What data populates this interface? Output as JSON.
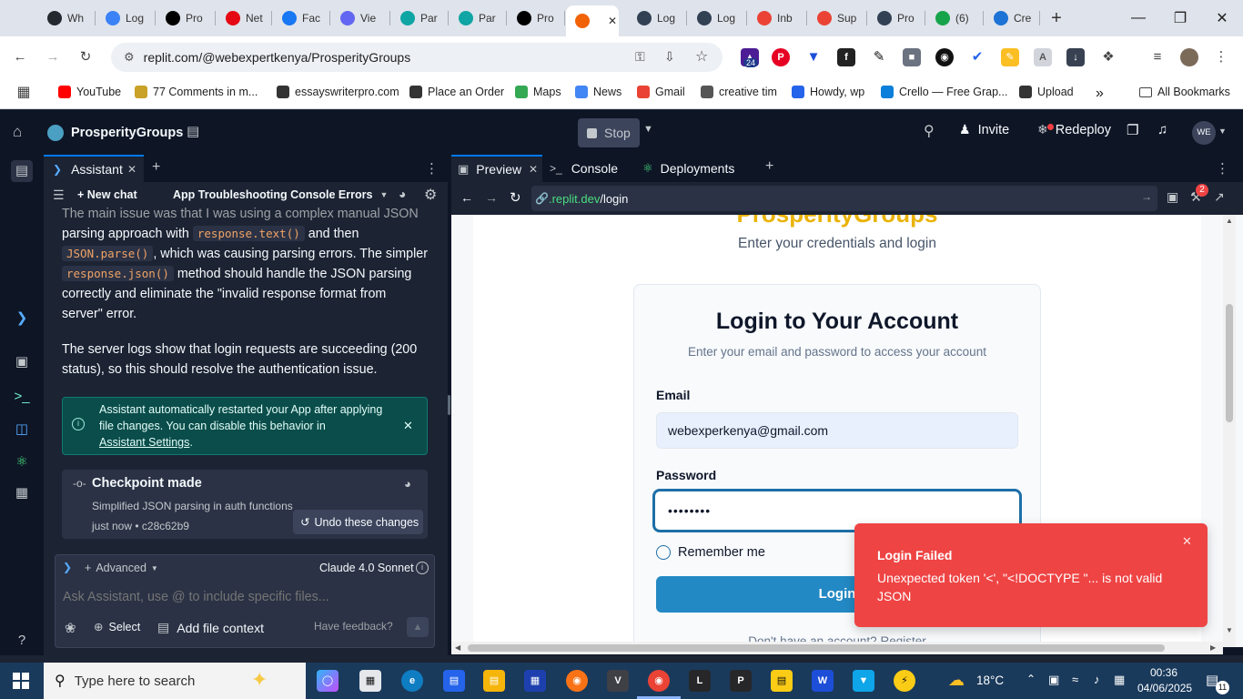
{
  "browser": {
    "tabs": [
      {
        "label": "Wh",
        "icon": "github-icon",
        "color": "#24292f"
      },
      {
        "label": "Log",
        "icon": "circle-icon",
        "color": "#3b82f6"
      },
      {
        "label": "Pro",
        "icon": "vercel-icon",
        "color": "#000000"
      },
      {
        "label": "Net",
        "icon": "netflix-icon",
        "color": "#e50914"
      },
      {
        "label": "Fac",
        "icon": "facebook-icon",
        "color": "#1877f2"
      },
      {
        "label": "Vie",
        "icon": "at-icon",
        "color": "#6366f1"
      },
      {
        "label": "Par",
        "icon": "parse-icon",
        "color": "#0ea5a4"
      },
      {
        "label": "Par",
        "icon": "parse-icon",
        "color": "#0ea5a4"
      },
      {
        "label": "Pro",
        "icon": "vercel-icon",
        "color": "#000000"
      },
      {
        "label": "",
        "icon": "replit-icon",
        "color": "#f26207",
        "active": true
      },
      {
        "label": "Log",
        "icon": "ios-icon",
        "color": "#334155"
      },
      {
        "label": "Log",
        "icon": "ios-icon",
        "color": "#334155"
      },
      {
        "label": "Inb",
        "icon": "gmail-icon",
        "color": "#ea4335"
      },
      {
        "label": "Sup",
        "icon": "gmail-icon",
        "color": "#ea4335"
      },
      {
        "label": "Pro",
        "icon": "ios-icon",
        "color": "#334155"
      },
      {
        "label": "(6)",
        "icon": "six-icon",
        "color": "#16a34a"
      },
      {
        "label": "Cre",
        "icon": "vscode-icon",
        "color": "#1d72d6"
      }
    ],
    "url": "replit.com/@webexpertkenya/ProsperityGroups",
    "ext_badge": "24",
    "bookmarks": [
      {
        "label": "YouTube",
        "color": "#ff0000"
      },
      {
        "label": "77 Comments in m...",
        "color": "#c9a227"
      },
      {
        "label": "essayswriterpro.com",
        "color": "#333333"
      },
      {
        "label": "Place an Order",
        "color": "#333333"
      },
      {
        "label": "Maps",
        "color": "#34a853"
      },
      {
        "label": "News",
        "color": "#4285f4"
      },
      {
        "label": "Gmail",
        "color": "#ea4335"
      },
      {
        "label": "creative tim",
        "color": "#555555"
      },
      {
        "label": "Howdy, wp",
        "color": "#2563eb"
      },
      {
        "label": "Crello — Free Grap...",
        "color": "#0b7fd9"
      },
      {
        "label": "Upload",
        "color": "#333333"
      }
    ],
    "all_bookmarks": "All Bookmarks"
  },
  "replit": {
    "project": "ProsperityGroups",
    "stop": "Stop",
    "invite": "Invite",
    "redeploy": "Redeploy",
    "avatar": "WE"
  },
  "assistant": {
    "tab": "Assistant",
    "new_chat": "+ New chat",
    "thread_title": "App Troubleshooting Console Errors",
    "line0": "The main issue was that I was using a complex manual JSON",
    "p1a": "parsing approach with",
    "code1": "response.text()",
    "p1b": "and then",
    "code2": "JSON.parse()",
    "p1c": ", which was causing parsing errors. The simpler",
    "code3": "response.json()",
    "p1d": "method should handle the JSON parsing",
    "p1e": "correctly and eliminate the \"invalid response format from",
    "p1f": "server\" error.",
    "p2a": "The server logs show that login requests are succeeding (200",
    "p2b": "status), so this should resolve the authentication issue.",
    "info_text": "Assistant automatically restarted your App after applying file changes. You can disable this behavior in",
    "info_link": "Assistant Settings",
    "info_end": ".",
    "checkpoint_title": "Checkpoint made",
    "checkpoint_desc": "Simplified JSON parsing in auth functions",
    "checkpoint_meta": "just now • c28c62b9",
    "undo": "Undo these changes",
    "advanced": "Advanced",
    "model": "Claude 4.0 Sonnet",
    "placeholder": "Ask Assistant, use @ to include specific files...",
    "select": "Select",
    "add_context": "Add file context",
    "feedback": "Have feedback?"
  },
  "workspace": {
    "tabs": [
      "Preview",
      "Console",
      "Deployments"
    ],
    "url_prefix": ".replit.dev",
    "url_path": "/login",
    "notif_badge": "2"
  },
  "login_page": {
    "brand": "ProsperityGroups",
    "subtitle": "Enter your credentials and login",
    "card_title": "Login to Your Account",
    "card_sub": "Enter your email and password to access your account",
    "email_label": "Email",
    "email_value": "webexperkenya@gmail.com",
    "password_label": "Password",
    "password_value": "••••••••",
    "remember": "Remember me",
    "login_button": "Login",
    "footer_partial": "Don't have an account? Register"
  },
  "toast": {
    "title": "Login Failed",
    "message": "Unexpected token '<', \"<!DOCTYPE \"... is not valid JSON"
  },
  "taskbar": {
    "search_placeholder": "Type here to search",
    "temperature": "18°C",
    "time": "00:36",
    "date": "04/06/2025",
    "notif_count": "11"
  }
}
